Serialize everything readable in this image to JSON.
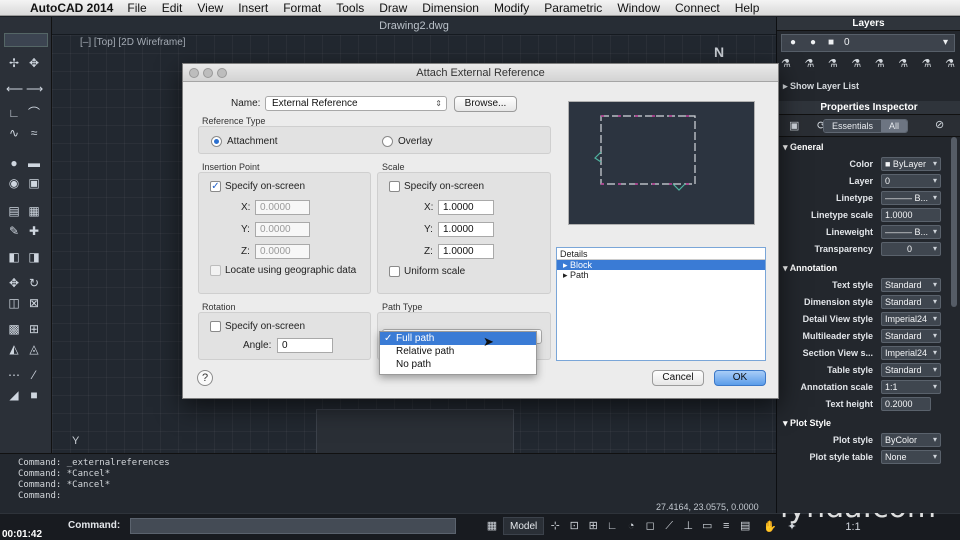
{
  "menubar": {
    "app_name": "AutoCAD 2014",
    "items": [
      "File",
      "Edit",
      "View",
      "Insert",
      "Format",
      "Tools",
      "Draw",
      "Dimension",
      "Modify",
      "Parametric",
      "Window",
      "Connect",
      "Help"
    ]
  },
  "drawing": {
    "title": "Drawing2.dwg",
    "viewport_label": "[–] [Top] [2D Wireframe]",
    "compass_label": "N",
    "ucs_label": "Y"
  },
  "command_history": [
    "Command: _externalreferences",
    "Command: *Cancel*",
    "Command: *Cancel*",
    "Command:"
  ],
  "coordinates": "27.4164, 23.0575, 0.0000",
  "statusbar": {
    "timecode": "00:01:42",
    "command_label": "Command:",
    "model_label": "Model",
    "scale_label": "1:1"
  },
  "watermark": "lynda.com",
  "layers_panel": {
    "title": "Layers",
    "current_layer": "0",
    "show_layer_list": "Show Layer List"
  },
  "properties_inspector": {
    "title": "Properties Inspector",
    "tabs": [
      "Essentials",
      "All"
    ],
    "sections": [
      {
        "name": "General",
        "props": [
          {
            "label": "Color",
            "value": "■ ByLayer"
          },
          {
            "label": "Layer",
            "value": "0"
          },
          {
            "label": "Linetype",
            "value": "——— B..."
          },
          {
            "label": "Linetype scale",
            "value": "1.0000"
          },
          {
            "label": "Lineweight",
            "value": "——— B..."
          },
          {
            "label": "Transparency",
            "value": "0"
          }
        ]
      },
      {
        "name": "Annotation",
        "props": [
          {
            "label": "Text style",
            "value": "Standard"
          },
          {
            "label": "Dimension style",
            "value": "Standard"
          },
          {
            "label": "Detail View style",
            "value": "Imperial24"
          },
          {
            "label": "Multileader style",
            "value": "Standard"
          },
          {
            "label": "Section View s...",
            "value": "Imperial24"
          },
          {
            "label": "Table style",
            "value": "Standard"
          },
          {
            "label": "Annotation scale",
            "value": "1:1"
          },
          {
            "label": "Text height",
            "value": "0.2000"
          }
        ]
      },
      {
        "name": "Plot Style",
        "props": [
          {
            "label": "Plot style",
            "value": "ByColor"
          },
          {
            "label": "Plot style table",
            "value": "None"
          }
        ]
      }
    ]
  },
  "dialog": {
    "title": "Attach External Reference",
    "name_label": "Name:",
    "name_value": "External Reference",
    "browse_label": "Browse...",
    "reference_type_header": "Reference Type",
    "attachment_label": "Attachment",
    "overlay_label": "Overlay",
    "insertion_point_header": "Insertion Point",
    "insertion_specify": "Specify on-screen",
    "insertion_x": "0.0000",
    "insertion_y": "0.0000",
    "insertion_z": "0.0000",
    "geo_label": "Locate using geographic data",
    "scale_header": "Scale",
    "scale_specify": "Specify on-screen",
    "scale_x": "1.0000",
    "scale_y": "1.0000",
    "scale_z": "1.0000",
    "uniform_scale": "Uniform scale",
    "rotation_header": "Rotation",
    "rotation_specify": "Specify on-screen",
    "angle_label": "Angle:",
    "angle_value": "0",
    "path_type_header": "Path Type",
    "path_options": [
      "Full path",
      "Relative path",
      "No path"
    ],
    "details_header": "Details",
    "details_rows": [
      "Block",
      "Path"
    ],
    "cancel_label": "Cancel",
    "ok_label": "OK",
    "help_label": "?",
    "x_label": "X:",
    "y_label": "Y:",
    "z_label": "Z:"
  },
  "colors": {
    "accent": "#3a7bd5",
    "preview_dash": "#c0409a"
  }
}
